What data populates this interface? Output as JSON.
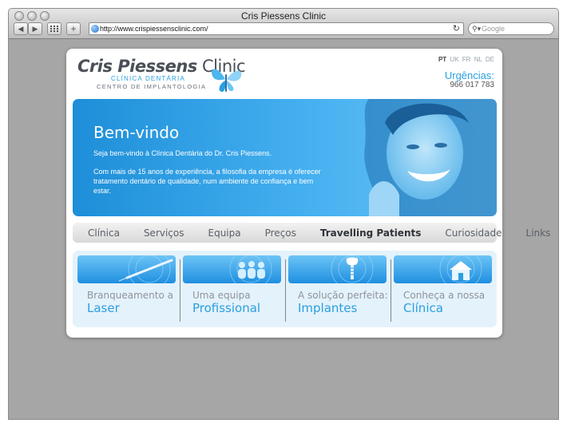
{
  "browser": {
    "window_title": "Cris Piessens Clinic",
    "url": "http://www.crispiessensclinic.com/",
    "search_placeholder": "Google",
    "back_label": "◀",
    "forward_label": "▶",
    "add_label": "+",
    "reload_label": "↻"
  },
  "header": {
    "logo": {
      "name_bold": "Cris Piessens",
      "name_thin": "Clinic",
      "subtitle1": "CLÍNICA DENTÁRIA",
      "subtitle2": "CENTRO DE IMPLANTOLOGIA"
    },
    "languages": [
      {
        "code": "PT",
        "active": true
      },
      {
        "code": "UK",
        "active": false
      },
      {
        "code": "FR",
        "active": false
      },
      {
        "code": "NL",
        "active": false
      },
      {
        "code": "DE",
        "active": false
      }
    ],
    "urgencias_label": "Urgências:",
    "urgencias_phone": "966 017 783"
  },
  "hero": {
    "title": "Bem-vindo",
    "paragraph1": "Seja bem-vindo à Clínica Dentária do Dr. Cris Piessens.",
    "paragraph2": "Com mais de 15 anos de experiência, a filosofia da empresa é oferecer tratamento dentário de qualidade, num ambiente de confiança e bem estar."
  },
  "menu": {
    "items": [
      {
        "label": "Clínica"
      },
      {
        "label": "Serviços"
      },
      {
        "label": "Equipa"
      },
      {
        "label": "Preços"
      },
      {
        "label": "Travelling Patients"
      },
      {
        "label": "Curiosidade"
      },
      {
        "label": "Links"
      }
    ]
  },
  "features": [
    {
      "line1": "Branqueamento a",
      "line2": "Laser",
      "icon": "laser-pen-icon"
    },
    {
      "line1": "Uma equipa",
      "line2": "Profissional",
      "icon": "team-icon"
    },
    {
      "line1": "A solução perfeita:",
      "line2": "Implantes",
      "icon": "tooth-implant-icon"
    },
    {
      "line1": "Conheça a nossa",
      "line2": "Clínica",
      "icon": "house-icon"
    }
  ],
  "colors": {
    "accent": "#2a9fe0",
    "hero_start": "#1d8ed8",
    "hero_end": "#6fc5f5",
    "window_background": "#a6a6a6"
  }
}
